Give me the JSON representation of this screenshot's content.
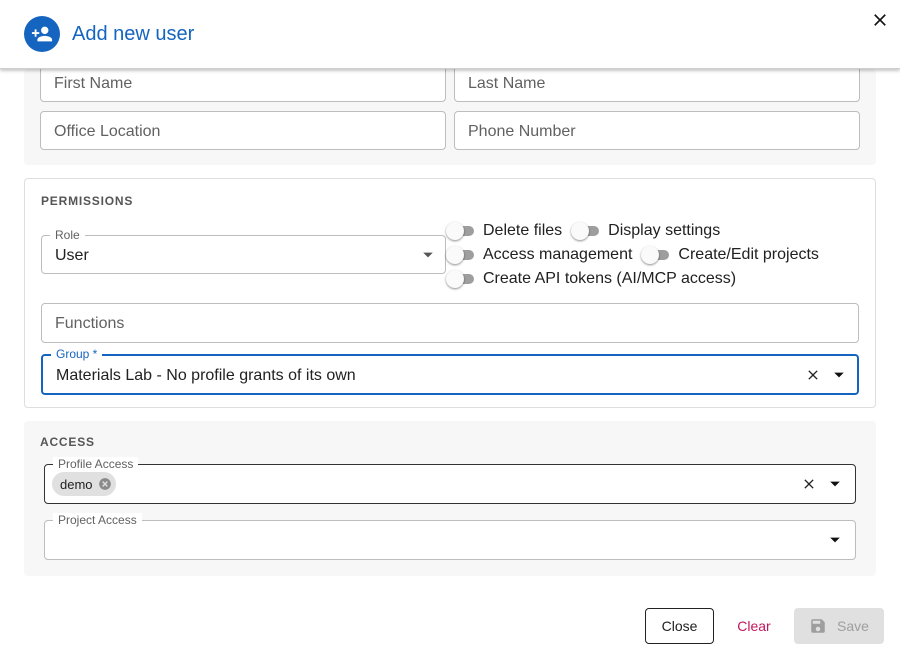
{
  "dialog": {
    "title": "Add new user",
    "close_icon": "close-icon",
    "avatar_icon": "person-add-icon"
  },
  "personal": {
    "first_name_placeholder": "First Name",
    "last_name_placeholder": "Last Name",
    "office_location_placeholder": "Office Location",
    "phone_number_placeholder": "Phone Number"
  },
  "permissions": {
    "heading": "PERMISSIONS",
    "role": {
      "label": "Role",
      "value": "User"
    },
    "toggles": [
      {
        "label": "Delete files",
        "on": false
      },
      {
        "label": "Display settings",
        "on": false
      },
      {
        "label": "Access management",
        "on": false
      },
      {
        "label": "Create/Edit projects",
        "on": false
      },
      {
        "label": "Create API tokens (AI/MCP access)",
        "on": false
      }
    ],
    "functions_placeholder": "Functions",
    "group": {
      "label": "Group *",
      "value": "Materials Lab - No profile grants of its own"
    }
  },
  "access": {
    "heading": "ACCESS",
    "profile_access": {
      "label": "Profile Access",
      "chips": [
        "demo"
      ]
    },
    "project_access": {
      "label": "Project Access",
      "value": ""
    }
  },
  "footer": {
    "close_label": "Close",
    "clear_label": "Clear",
    "save_label": "Save"
  },
  "colors": {
    "primary": "#1565c0",
    "clear_text": "#c2185b",
    "disabled_bg": "#e0e0e0",
    "disabled_text": "#9e9e9e"
  }
}
